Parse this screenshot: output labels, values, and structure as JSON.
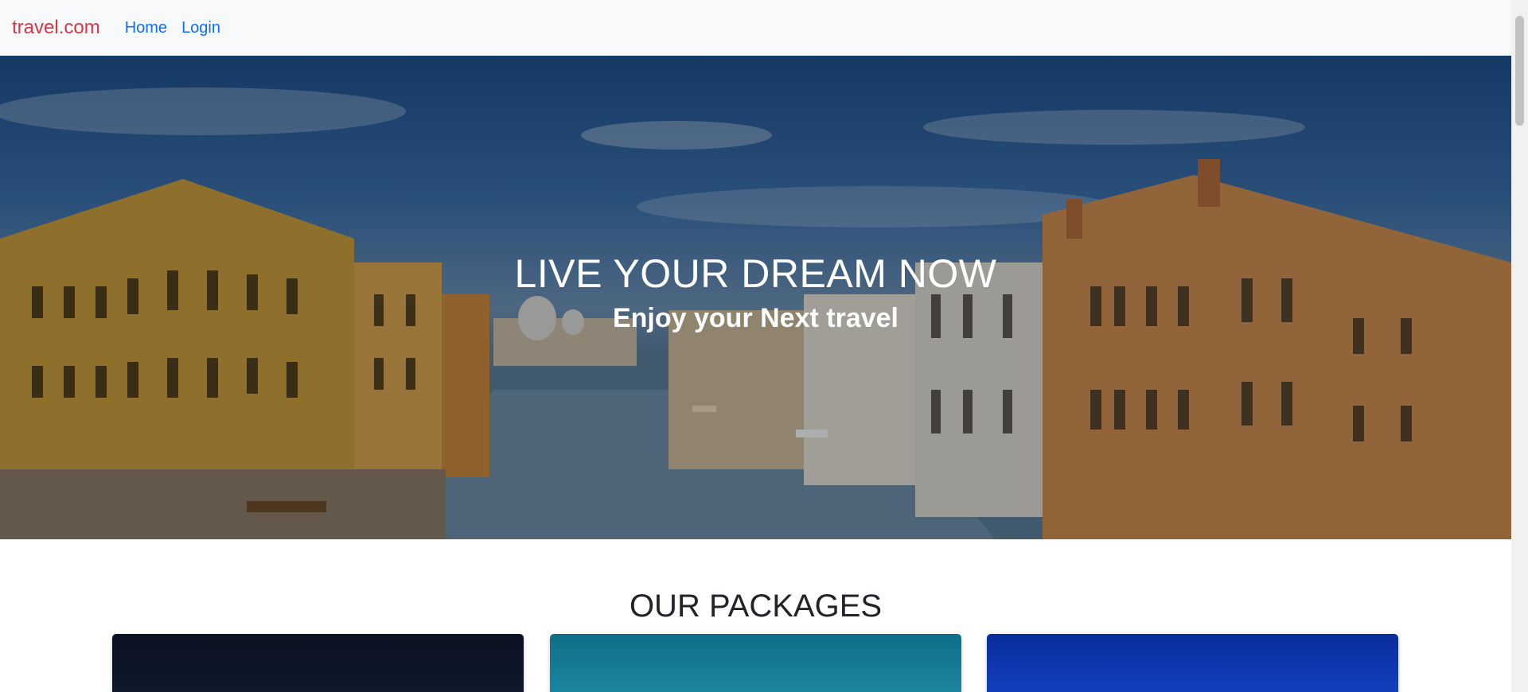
{
  "navbar": {
    "brand": "travel.com",
    "links": [
      "Home",
      "Login"
    ]
  },
  "hero": {
    "title": "LIVE YOUR DREAM NOW",
    "subtitle": "Enjoy your Next travel"
  },
  "packages": {
    "title": "OUR PACKAGES"
  },
  "colors": {
    "brand": "#dc3545",
    "link": "#0d6efd",
    "navbar_bg": "#f8f9fa"
  }
}
